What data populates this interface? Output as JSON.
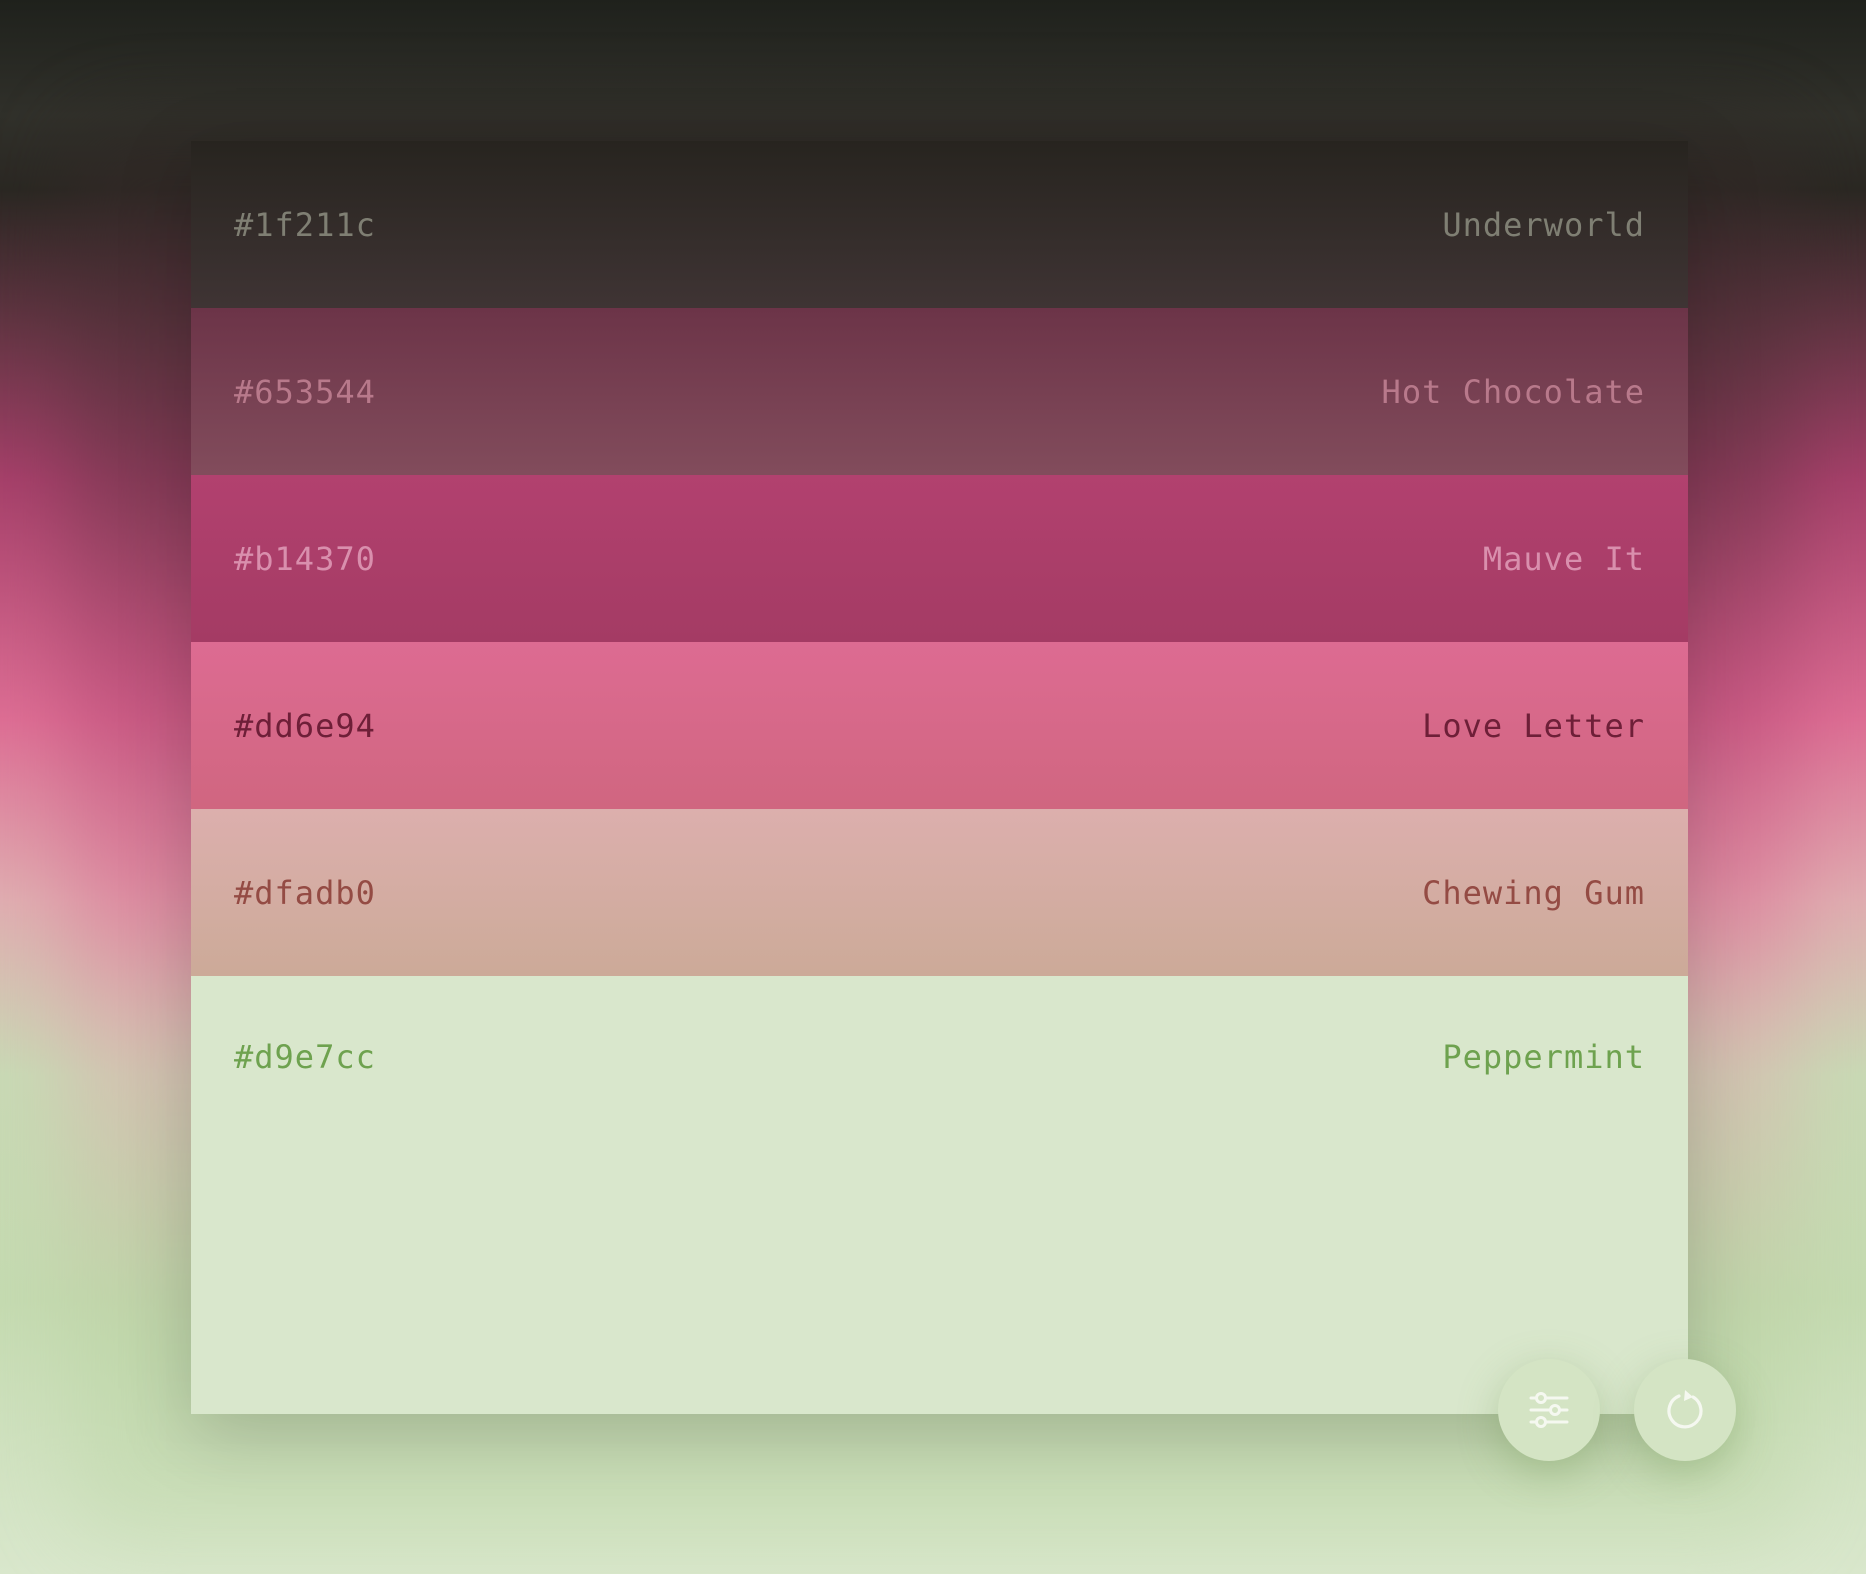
{
  "palette": {
    "swatches": [
      {
        "hex": "#1f211c",
        "name": "Underworld",
        "bg_top": "#27241f",
        "bg_bottom": "#3f3434",
        "text": "#7f7f73"
      },
      {
        "hex": "#653544",
        "name": "Hot Chocolate",
        "bg_top": "#6c3448",
        "bg_bottom": "#824c5c",
        "text": "#b8798b"
      },
      {
        "hex": "#b14370",
        "name": "Mauve It",
        "bg_top": "#b2416f",
        "bg_bottom": "#a43b64",
        "text": "#d98fad"
      },
      {
        "hex": "#dd6e94",
        "name": "Love Letter",
        "bg_top": "#dd6b92",
        "bg_bottom": "#d06680",
        "text": "#6e1f38"
      },
      {
        "hex": "#dfadb0",
        "name": "Chewing Gum",
        "bg_top": "#dcafad",
        "bg_bottom": "#ccaa98",
        "text": "#944b44"
      },
      {
        "hex": "#d9e7cc",
        "name": "Peppermint",
        "bg_top": "#d9e7cc",
        "bg_bottom": "#d9e7cc",
        "text": "#6ea24f"
      }
    ]
  },
  "controls": {
    "settings_icon": "sliders-icon",
    "refresh_icon": "refresh-icon",
    "button_color": "#d4e4c4",
    "icon_color": "#f5f8f0"
  }
}
